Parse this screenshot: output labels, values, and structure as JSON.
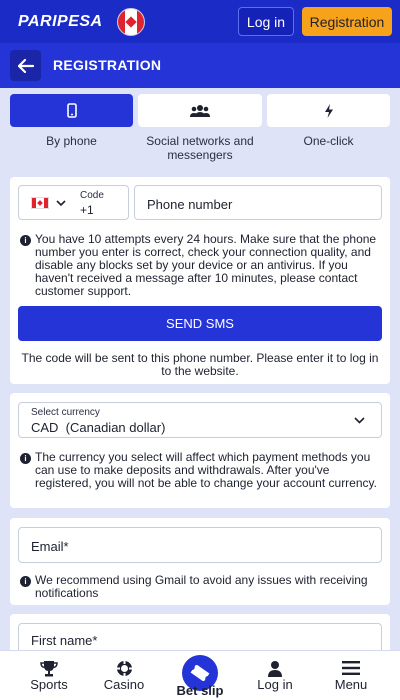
{
  "header": {
    "logo": "PARIPESA",
    "login_label": "Log in",
    "registration_label": "Registration"
  },
  "page": {
    "title": "REGISTRATION"
  },
  "tabs": [
    {
      "label": "By phone",
      "icon": "phone-icon",
      "active": true
    },
    {
      "label": "Social networks and messengers",
      "icon": "users-icon",
      "active": false
    },
    {
      "label": "One-click",
      "icon": "lightning-icon",
      "active": false
    }
  ],
  "phone_section": {
    "code_label": "Code",
    "code_value": "+1",
    "phone_placeholder": "Phone number",
    "attempts_info": "You have 10 attempts every 24 hours. Make sure that the phone number you enter is correct, check your connection quality, and disable any blocks set by your device or an antivirus. If you haven't received a message after 10 minutes, please contact customer support.",
    "send_sms_label": "SEND SMS",
    "code_note": "The code will be sent to this phone number. Please enter it to log in to the website."
  },
  "currency_section": {
    "label": "Select currency",
    "value": "CAD  (Canadian dollar)",
    "info": "The currency you select will affect which payment methods you can use to make deposits and withdrawals. After you've registered, you will not be able to change your account currency."
  },
  "email_section": {
    "placeholder": "Email*",
    "info": "We recommend using Gmail to avoid any issues with receiving notifications"
  },
  "name_section": {
    "placeholder": "First name*"
  },
  "bottom_nav": {
    "items": [
      {
        "label": "Sports",
        "icon": "trophy-icon"
      },
      {
        "label": "Casino",
        "icon": "casino-chip-icon"
      },
      {
        "label": "Bet slip",
        "icon": "ticket-icon"
      },
      {
        "label": "Log in",
        "icon": "user-icon"
      },
      {
        "label": "Menu",
        "icon": "hamburger-icon"
      }
    ]
  },
  "colors": {
    "primary": "#2534d6",
    "topbar": "#1b2bc6",
    "accent": "#f7a21b",
    "background": "#dfe3f7"
  }
}
